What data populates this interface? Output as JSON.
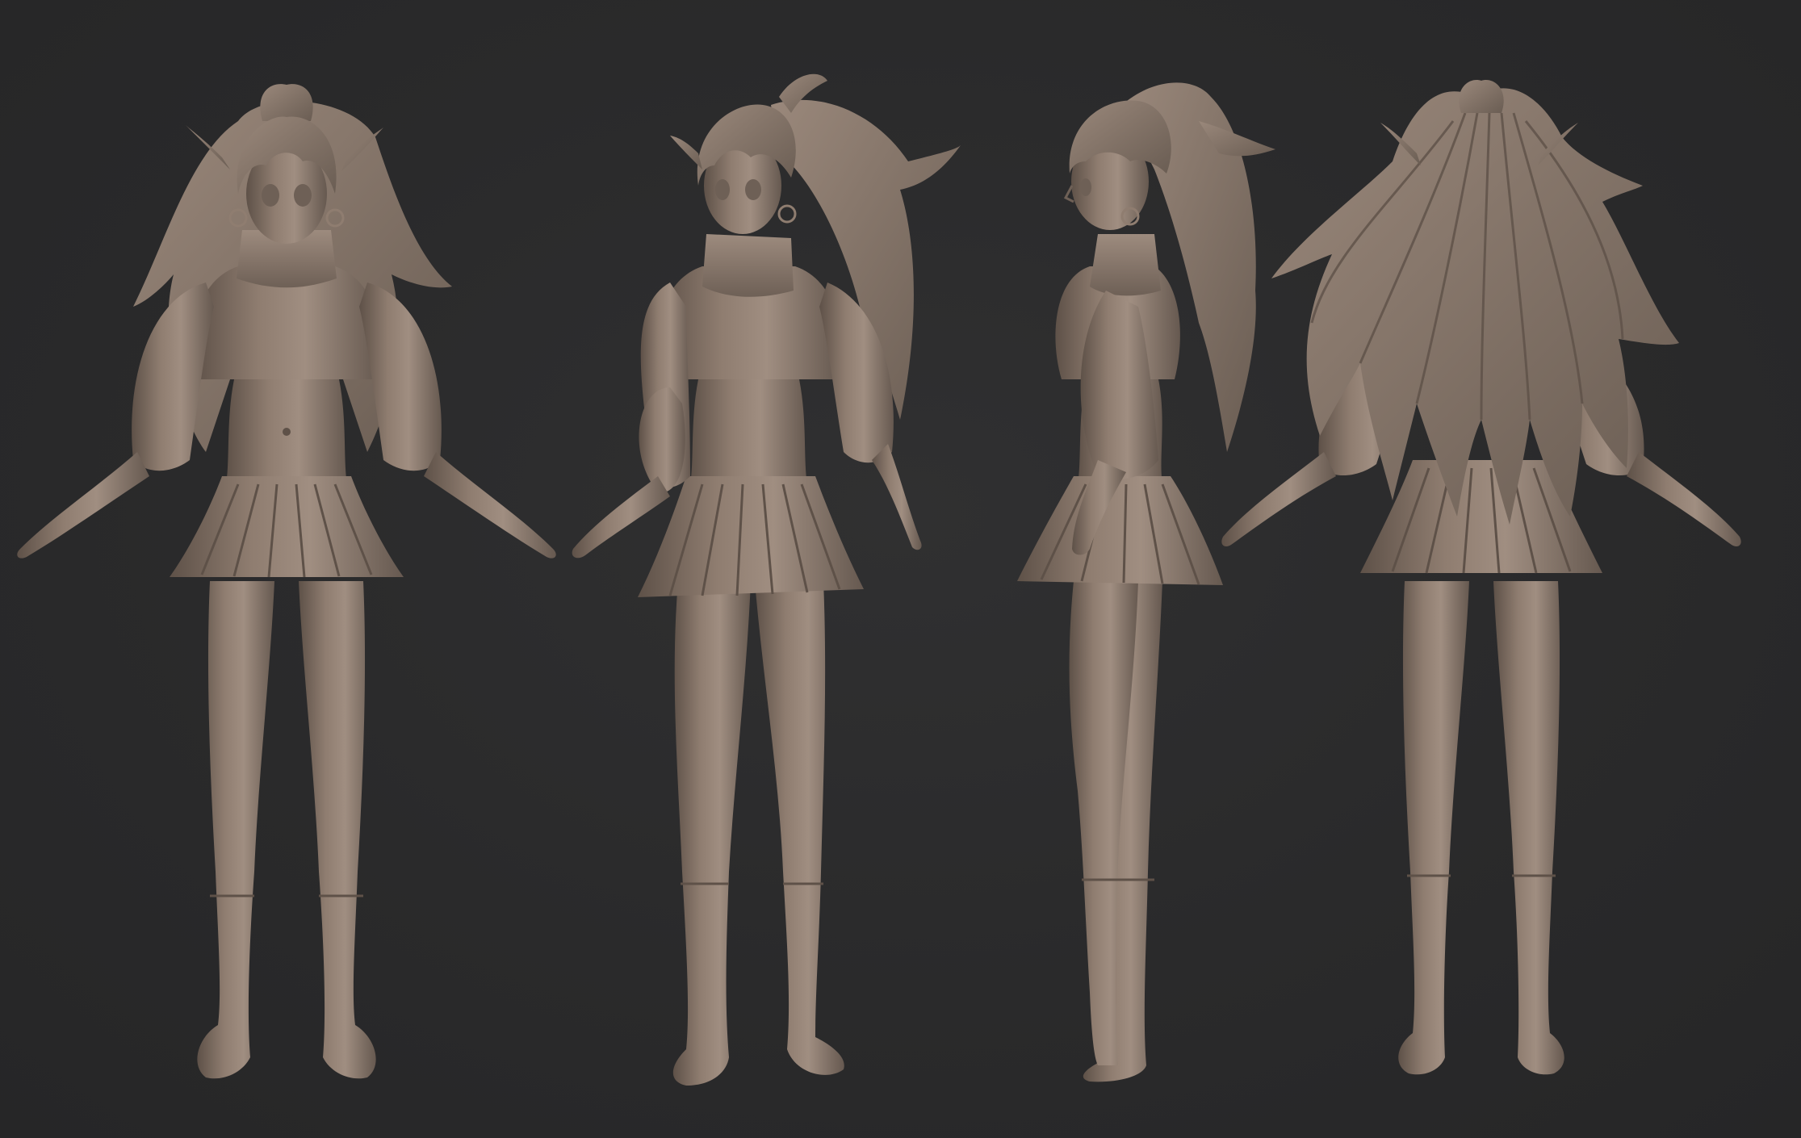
{
  "scene": {
    "background_color": "#2a2a2b",
    "clay_color": "#8c7a6c",
    "clay_shadow_color": "#5e5148",
    "clay_highlight_color": "#a8968a",
    "views": [
      {
        "id": "front",
        "name": "front-view"
      },
      {
        "id": "three-quarter",
        "name": "three-quarter-view"
      },
      {
        "id": "side",
        "name": "side-view"
      },
      {
        "id": "back",
        "name": "back-view"
      }
    ]
  }
}
